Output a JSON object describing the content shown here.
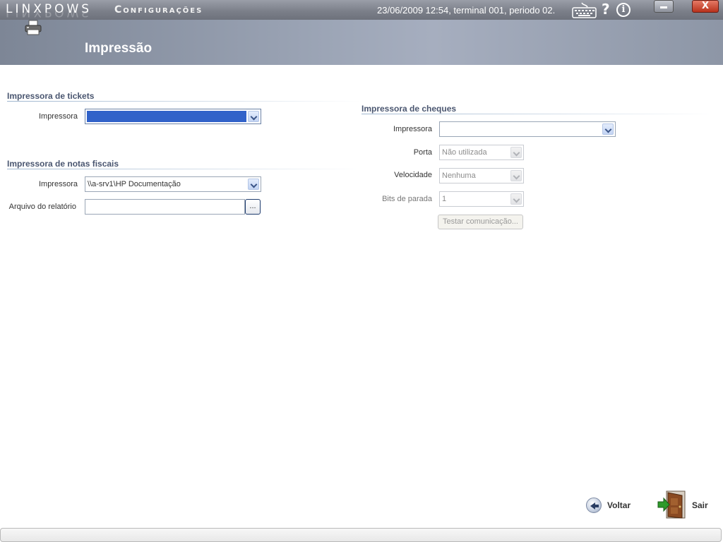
{
  "titlebar": {
    "brand": "LINXPOWS",
    "app_name": "Configurações",
    "status": "23/06/2009 12:54, terminal 001, periodo 02.",
    "close_glyph": "X"
  },
  "header": {
    "title": "Impressão",
    "icon": "printer-icon"
  },
  "tickets": {
    "title": "Impressora de tickets",
    "printer_label": "Impressora",
    "printer_value": ""
  },
  "notas": {
    "title": "Impressora de notas fiscais",
    "printer_label": "Impressora",
    "printer_value": "\\\\a-srv1\\HP Documentação",
    "report_label": "Arquivo do relatório",
    "report_value": "",
    "browse_label": "..."
  },
  "cheques": {
    "title": "Impressora de cheques",
    "printer_label": "Impressora",
    "printer_value": "",
    "port_label": "Porta",
    "port_value": "Não utilizada",
    "speed_label": "Velocidade",
    "speed_value": "Nenhuma",
    "stopbits_label": "Bits de parada",
    "stopbits_value": "1",
    "test_label": "Testar comunicação..."
  },
  "footer": {
    "back_label": "Voltar",
    "exit_label": "Sair"
  },
  "colors": {
    "selection": "#3162c9",
    "section_title": "#4a5670",
    "header_band": "#9ca5b6"
  }
}
